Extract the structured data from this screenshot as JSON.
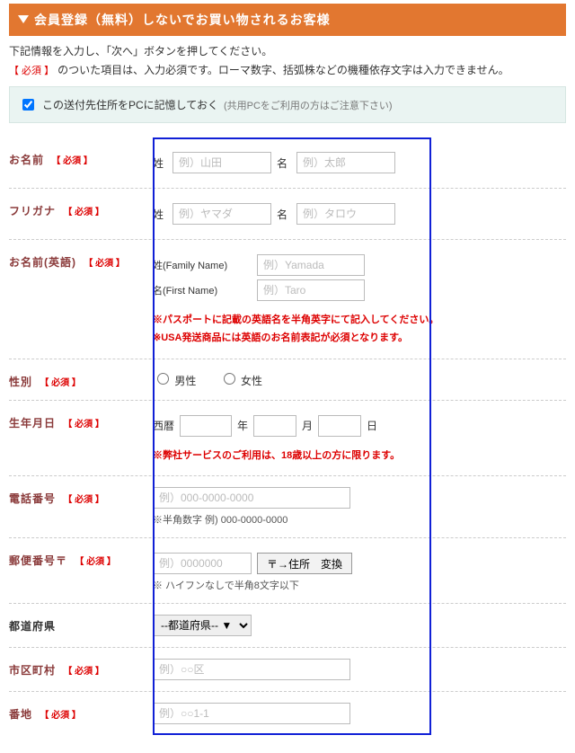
{
  "header": {
    "title": "会員登録（無料）しないでお買い物されるお客様"
  },
  "intro": {
    "line1": "下記情報を入力し、「次へ」ボタンを押してください。",
    "required_badge": "【 必須 】",
    "line2": "のついた項目は、入力必須です。ローマ数字、括弧株などの機種依存文字は入力できません。"
  },
  "remember": {
    "label_main": "この送付先住所をPCに記憶しておく",
    "label_sub": "(共用PCをご利用の方はご注意下さい)"
  },
  "fields": {
    "name": {
      "label": "お名前",
      "required": "【 必須 】",
      "sei": "姓",
      "mei": "名",
      "ph_sei": "例）山田",
      "ph_mei": "例）太郎"
    },
    "kana": {
      "label": "フリガナ",
      "required": "【 必須 】",
      "sei": "姓",
      "mei": "名",
      "ph_sei": "例）ヤマダ",
      "ph_mei": "例）タロウ"
    },
    "name_en": {
      "label": "お名前(英語)",
      "required": "【 必須 】",
      "family_label": "姓(Family Name)",
      "first_label": "名(First Name)",
      "ph_family": "例）Yamada",
      "ph_first": "例）Taro",
      "note1": "※パスポートに記載の英語名を半角英字にて記入してください。",
      "note2": "※USA発送商品には英語のお名前表記が必須となります。"
    },
    "gender": {
      "label": "性別",
      "required": "【 必須 】",
      "male": "男性",
      "female": "女性"
    },
    "birth": {
      "label": "生年月日",
      "required": "【 必須 】",
      "era": "西暦",
      "y": "年",
      "m": "月",
      "d": "日",
      "note": "※弊社サービスのご利用は、18歳以上の方に限ります。"
    },
    "phone": {
      "label": "電話番号",
      "required": "【 必須 】",
      "ph": "例）000-0000-0000",
      "note": "※半角数字 例) 000-0000-0000"
    },
    "postal": {
      "label": "郵便番号〒",
      "required": "【 必須 】",
      "ph": "例）0000000",
      "btn": "〒→住所　変換",
      "note": "※ ハイフンなしで半角8文字以下"
    },
    "pref": {
      "label": "都道府県",
      "placeholder": "--都道府県-- ▼"
    },
    "city": {
      "label": "市区町村",
      "required": "【 必須 】",
      "ph": "例）○○区"
    },
    "street": {
      "label": "番地",
      "required": "【 必須 】",
      "ph": "例）○○1-1"
    }
  }
}
